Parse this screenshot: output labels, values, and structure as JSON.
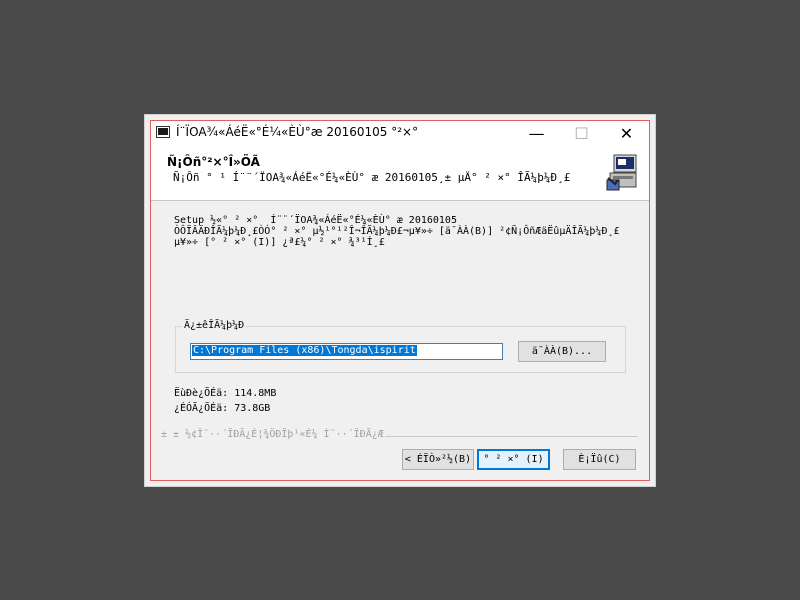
{
  "window": {
    "title": "Í¨ÏOA¾«ÁéË«°É¼«ÈÙ°æ 20160105 °²×°",
    "controls": {
      "minimize": "—",
      "maximize": "☐",
      "close": "✕"
    }
  },
  "header": {
    "title": "Ñ¡Ôñ°²×°Î»ÖÃ",
    "subtitle": "Ñ¡Ôñ ° ¹ Í¨¨´ÏOA¾«ÁéË«°É¼«ÈÙ° æ 20160105¸± µÄ° ² ×° ÎÃ¼þ¼Ð¸£"
  },
  "description": [
    "Setup ½«° ² ×°  Í¨¨´ÏOA¾«ÁéË«°É¼«ÈÙ° æ 20160105",
    "ÒÔÏÂÄÐÎÃ¼þ¼Ð¸£ÒÓ° ² ×° µ½¹°¹²Î¬ÎÃ¼þ¼Ð£¬µ¥»÷ [ä¯ÀÀ(B)] ²¢Ñ¡ÔñÆäËûµÄÎÃ¼þ¼Ð¸£",
    "µ¥»÷ [° ² ×° (I)] ¿ª£¼° ² ×° ¾³¹Í¸£"
  ],
  "destination": {
    "group_label": "Ä¿±êÎÃ¼þ¼Ð",
    "path": "C:\\Program Files (x86)\\Tongda\\ispirit",
    "browse_label": "ä¯ÀÀ(B)..."
  },
  "space": {
    "required": "ËùÐè¿ÕÉä: 114.8MB",
    "available": "¿ÉÓÃ¿ÕÉä: 73.8GB"
  },
  "separator_text": "± ± ½¢Î¨··´ÏÐÃ¿É¦¾ÖÐÏþ¹«É¼ Í¨··´ÏÐÃ¿Æ",
  "buttons": {
    "back": "< ÉÏÒ»²½(B)",
    "install": "° ² ×° (I)",
    "cancel": "È¡Ïû(C)"
  },
  "colors": {
    "desktop": "#4a4a4a",
    "accent": "#0078d7",
    "frame": "#e06060"
  }
}
